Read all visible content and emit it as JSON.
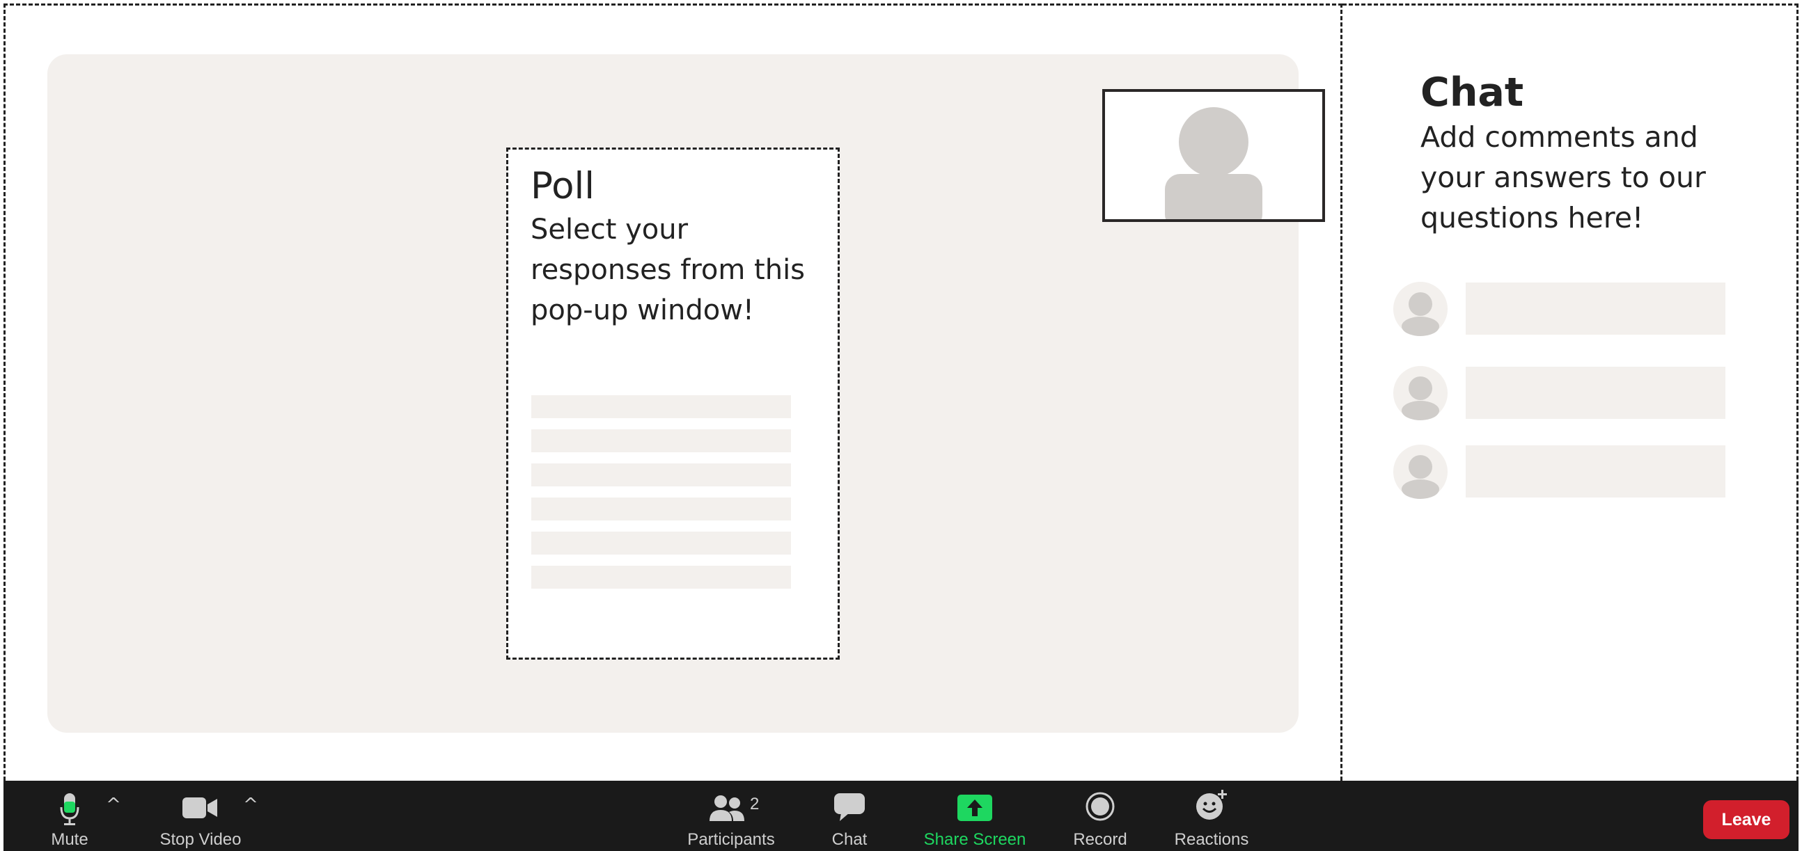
{
  "poll": {
    "title": "Poll",
    "description": "Select your responses from this pop-up window!",
    "option_count": 6
  },
  "chat": {
    "title": "Chat",
    "description": "Add comments and your answers to our questions here!",
    "message_count": 3
  },
  "toolbar": {
    "mute_label": "Mute",
    "video_label": "Stop Video",
    "participants_label": "Participants",
    "participants_count": "2",
    "chat_label": "Chat",
    "share_label": "Share Screen",
    "record_label": "Record",
    "reactions_label": "Reactions",
    "leave_label": "Leave",
    "caret": "^"
  },
  "colors": {
    "toolbar_bg": "#1a1a1a",
    "share_accent": "#1ed760",
    "leave_red": "#d21f2c",
    "placeholder_gray": "#f3f0ed",
    "avatar_gray": "#d0cdca"
  },
  "icons": {
    "mute": "microphone-icon",
    "video": "video-camera-icon",
    "participants": "people-icon",
    "chat": "speech-bubble-icon",
    "share": "share-arrow-icon",
    "record": "record-icon",
    "reactions": "smiley-plus-icon",
    "caret": "chevron-up-icon"
  }
}
